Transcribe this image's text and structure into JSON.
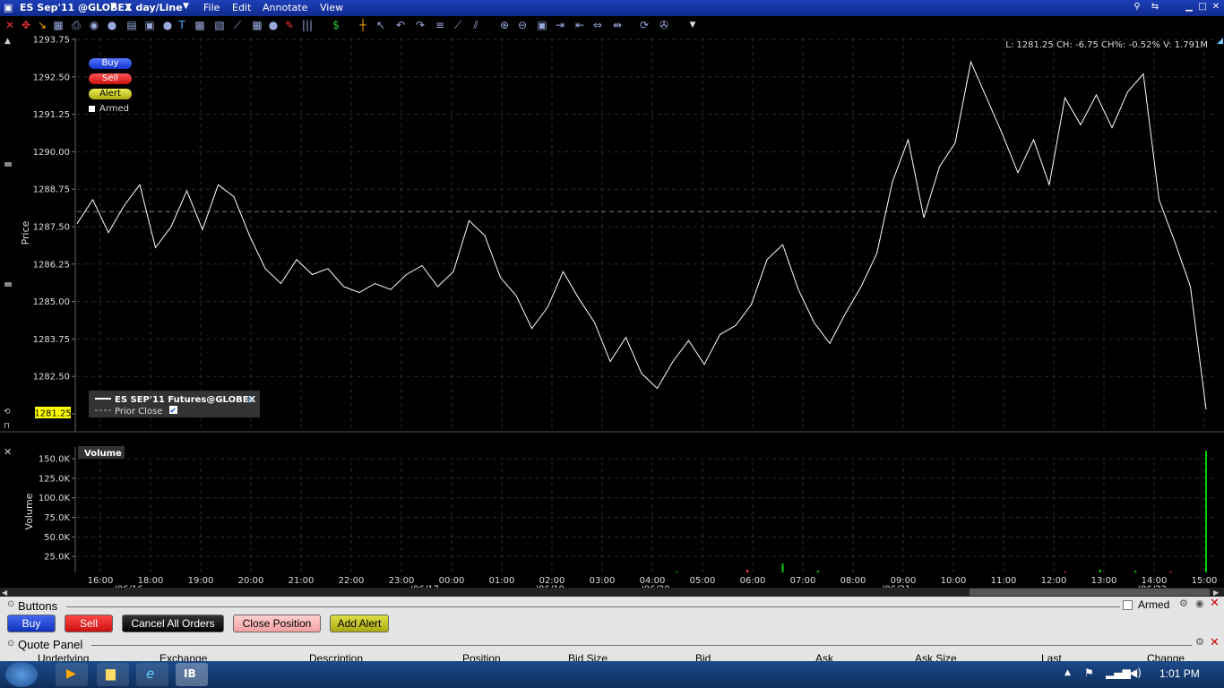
{
  "titlebar": {
    "symbol": "ES Sep'11 @GLOBEX",
    "interval": "1 day/Line",
    "menus": [
      "File",
      "Edit",
      "Annotate",
      "View"
    ]
  },
  "header_stats": "L: 1281.25 CH: -6.75 CH%: -0.52% V: 1.791M",
  "trade_buttons": {
    "buy": "Buy",
    "sell": "Sell",
    "alert": "Alert",
    "armed": "Armed"
  },
  "legend": {
    "series": "ES SEP'11 Futures@GLOBEX",
    "prior_close": "Prior Close"
  },
  "current_price_tag": "1281.25",
  "volume_panel_title": "Volume",
  "colors": {
    "price_line": "#ffffff",
    "volume_up": "#00cc00",
    "volume_down": "#ff4444",
    "price_tag_bg": "#ffff00",
    "titlebar": "#1d3fb8"
  },
  "chart_data": [
    {
      "type": "line",
      "ylabel": "Price",
      "yticks": [
        "1293.75",
        "1292.50",
        "1291.25",
        "1290.00",
        "1288.75",
        "1287.50",
        "1286.25",
        "1285.00",
        "1283.75",
        "1282.50",
        "1281.25"
      ],
      "ylim": [
        1281.25,
        1293.75
      ],
      "prior_close": 1288.0,
      "x": [
        "16:00",
        "18:00",
        "19:00",
        "20:00",
        "21:00",
        "22:00",
        "23:00",
        "00:00",
        "01:00",
        "02:00",
        "03:00",
        "04:00",
        "05:00",
        "06:00",
        "07:00",
        "08:00",
        "09:00",
        "10:00",
        "11:00",
        "12:00",
        "13:00",
        "14:00",
        "15:00"
      ],
      "series": [
        {
          "values": [
            1287.6,
            1288.4,
            1287.3,
            1288.2,
            1288.9,
            1286.8,
            1287.5,
            1288.7,
            1287.4,
            1288.9,
            1288.5,
            1287.2,
            1286.1,
            1285.6,
            1286.4,
            1285.9,
            1286.1,
            1285.5,
            1285.3,
            1285.6,
            1285.4,
            1285.9,
            1286.2,
            1285.5,
            1286.0,
            1287.7,
            1287.2,
            1285.8,
            1285.2,
            1284.1,
            1284.8,
            1286.0,
            1285.1,
            1284.3,
            1283.0,
            1283.8,
            1282.6,
            1282.1,
            1283.0,
            1283.7,
            1282.9,
            1283.9,
            1284.2,
            1284.9,
            1286.4,
            1286.9,
            1285.4,
            1284.3,
            1283.6,
            1284.6,
            1285.5,
            1286.6,
            1289.0,
            1290.4,
            1287.8,
            1289.5,
            1290.3,
            1293.0,
            1291.8,
            1290.6,
            1289.3,
            1290.4,
            1288.9,
            1291.8,
            1290.9,
            1291.9,
            1290.8,
            1292.0,
            1292.6,
            1288.4,
            1287.0,
            1285.5,
            1281.4
          ]
        }
      ]
    },
    {
      "type": "bar",
      "ylabel": "Volume",
      "yticks": [
        "150.0K",
        "125.0K",
        "100.0K",
        "75.0K",
        "50.0K",
        "25.0K"
      ],
      "ylim": [
        0,
        165000
      ],
      "values": [
        200,
        500,
        300,
        200,
        100,
        200,
        100,
        200,
        300,
        300,
        200,
        400,
        300,
        400,
        500,
        500,
        2000,
        6000,
        4000,
        8000,
        16000,
        7000,
        5000,
        4000,
        3000,
        4000,
        5000,
        3000,
        6000,
        8000,
        7000,
        6000,
        160000
      ]
    }
  ],
  "x_dates": [
    "'06/16",
    "'06/17",
    "'06/19",
    "'06/20",
    "'06/21",
    "'06/22"
  ],
  "buttons_panel": {
    "title": "Buttons",
    "buttons": [
      "Buy",
      "Sell",
      "Cancel All Orders",
      "Close Position",
      "Add Alert"
    ],
    "armed": "Armed"
  },
  "quote_panel": {
    "title": "Quote Panel",
    "columns": [
      "Underlying",
      "Exchange",
      "Description",
      "Position",
      "Bid Size",
      "Bid",
      "Ask",
      "Ask Size",
      "Last",
      "Change"
    ]
  },
  "taskbar": {
    "time": "1:01 PM",
    "app": "IB"
  }
}
